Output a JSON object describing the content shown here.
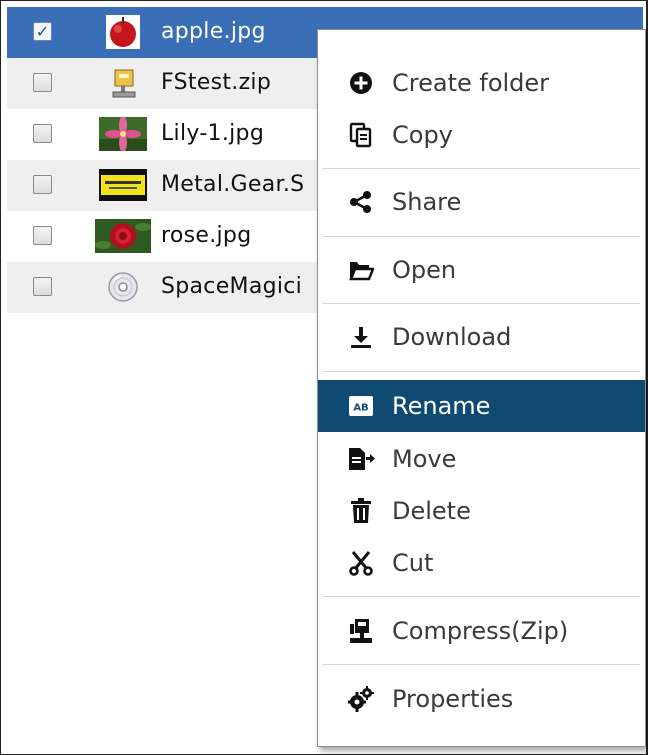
{
  "files": [
    {
      "name": "apple.jpg",
      "checked": true,
      "icon": "apple-thumbnail-icon"
    },
    {
      "name": "FStest.zip",
      "checked": false,
      "icon": "zip-archive-icon"
    },
    {
      "name": "Lily-1.jpg",
      "checked": false,
      "icon": "lily-thumbnail-icon"
    },
    {
      "name": "Metal.Gear.S",
      "checked": false,
      "icon": "metal-gear-thumbnail-icon"
    },
    {
      "name": "rose.jpg",
      "checked": false,
      "icon": "rose-thumbnail-icon"
    },
    {
      "name": "SpaceMagici",
      "checked": false,
      "icon": "disc-icon"
    }
  ],
  "menu": {
    "items": [
      {
        "label": "Create folder",
        "icon": "plus-circle-icon"
      },
      {
        "label": "Copy",
        "icon": "copy-icon"
      },
      {
        "label": "Share",
        "icon": "share-icon"
      },
      {
        "label": "Open",
        "icon": "folder-open-icon"
      },
      {
        "label": "Download",
        "icon": "download-icon"
      },
      {
        "label": "Rename",
        "icon": "rename-icon",
        "highlighted": true
      },
      {
        "label": "Move",
        "icon": "move-icon"
      },
      {
        "label": "Delete",
        "icon": "trash-icon"
      },
      {
        "label": "Cut",
        "icon": "scissors-icon"
      },
      {
        "label": "Compress(Zip)",
        "icon": "compress-icon"
      },
      {
        "label": "Properties",
        "icon": "gears-icon"
      }
    ],
    "rename_badge": "AB"
  },
  "colors": {
    "selected_row": "#3a6fb8",
    "menu_highlight": "#0e4a72",
    "alt_row": "#efefef"
  }
}
